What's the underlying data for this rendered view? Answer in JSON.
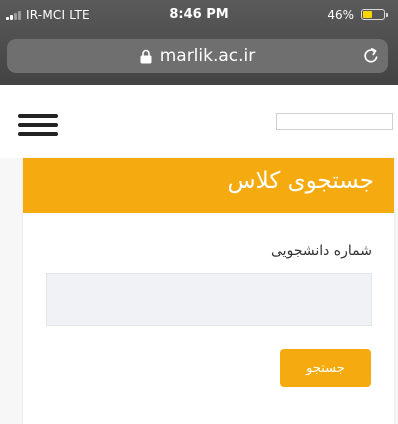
{
  "status_bar": {
    "carrier": "IR-MCI  LTE",
    "time": "8:46 PM",
    "battery_percent": "46%",
    "battery_level": 0.46,
    "battery_color": "#ffd500"
  },
  "browser": {
    "url": "marlik.ac.ir",
    "icons": [
      "lock-icon",
      "reload-icon"
    ]
  },
  "header": {
    "menu_icon": "hamburger-menu-icon",
    "search_value": ""
  },
  "card": {
    "title": "جستجوی کلاس",
    "accent_color": "#f5ab10",
    "field_label": "شماره دانشجویی",
    "field_value": "",
    "submit_label": "جستجو"
  }
}
